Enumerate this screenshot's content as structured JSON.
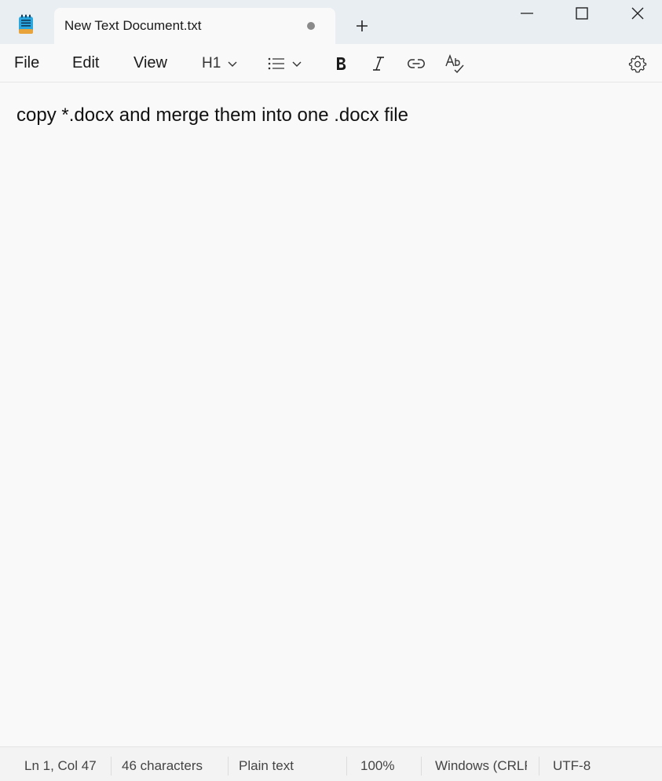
{
  "app": {
    "icon": "notepad-icon",
    "tab_title": "New Text Document.txt",
    "new_tab": "+",
    "colors": {
      "titlebar": "#e8eef2",
      "editor_bg": "#f9f9f9",
      "icon_blue": "#2ba7e0"
    }
  },
  "menu": {
    "file": "File",
    "edit": "Edit",
    "view": "View"
  },
  "toolbar": {
    "heading": "H1",
    "icons": [
      "chevron-down-icon",
      "bulleted-list-icon",
      "bold-icon",
      "italic-icon",
      "link-icon",
      "spell-check-icon",
      "gear-icon"
    ]
  },
  "editor": {
    "content": "copy *.docx and merge them into one .docx file"
  },
  "status": {
    "position": "Ln 1, Col 47",
    "characters": "46 characters",
    "format": "Plain text",
    "zoom": "100%",
    "line_ending": "Windows (CRLF)",
    "encoding": "UTF-8"
  }
}
